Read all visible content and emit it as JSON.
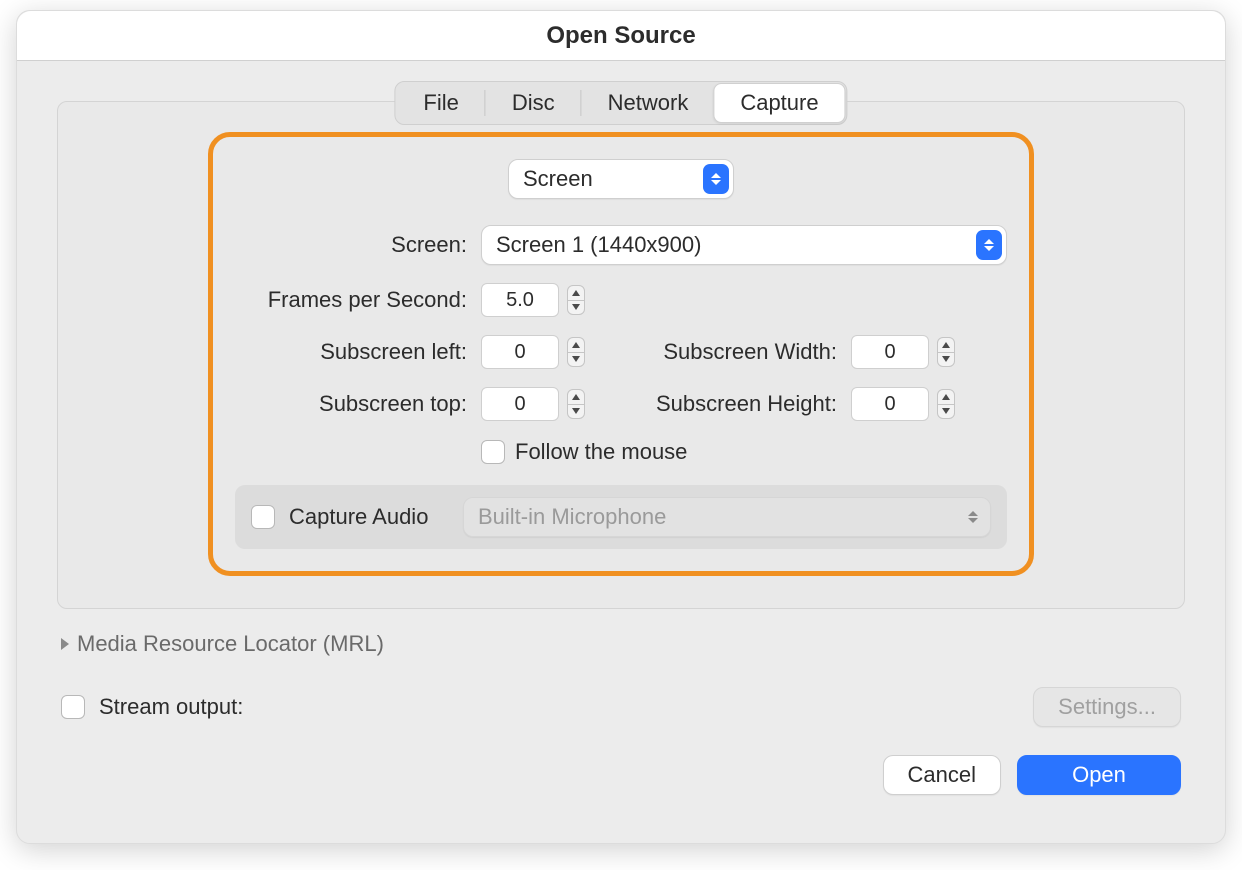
{
  "window": {
    "title": "Open Source"
  },
  "tabs": {
    "file": "File",
    "disc": "Disc",
    "network": "Network",
    "capture": "Capture",
    "active": "capture"
  },
  "capture": {
    "mode_select": "Screen",
    "screen_label": "Screen:",
    "screen_value": "Screen 1 (1440x900)",
    "fps_label": "Frames per Second:",
    "fps_value": "5.0",
    "sub_left_label": "Subscreen left:",
    "sub_left_value": "0",
    "sub_width_label": "Subscreen Width:",
    "sub_width_value": "0",
    "sub_top_label": "Subscreen top:",
    "sub_top_value": "0",
    "sub_height_label": "Subscreen Height:",
    "sub_height_value": "0",
    "follow_mouse_label": "Follow the mouse",
    "follow_mouse_checked": false,
    "capture_audio_label": "Capture Audio",
    "capture_audio_checked": false,
    "audio_device": "Built-in Microphone"
  },
  "disclosure": {
    "mrl_label": "Media Resource Locator (MRL)"
  },
  "stream": {
    "label": "Stream output:",
    "checked": false,
    "settings_label": "Settings..."
  },
  "buttons": {
    "cancel": "Cancel",
    "open": "Open"
  },
  "colors": {
    "highlight_box": "#f09021",
    "accent": "#2a74ff"
  }
}
